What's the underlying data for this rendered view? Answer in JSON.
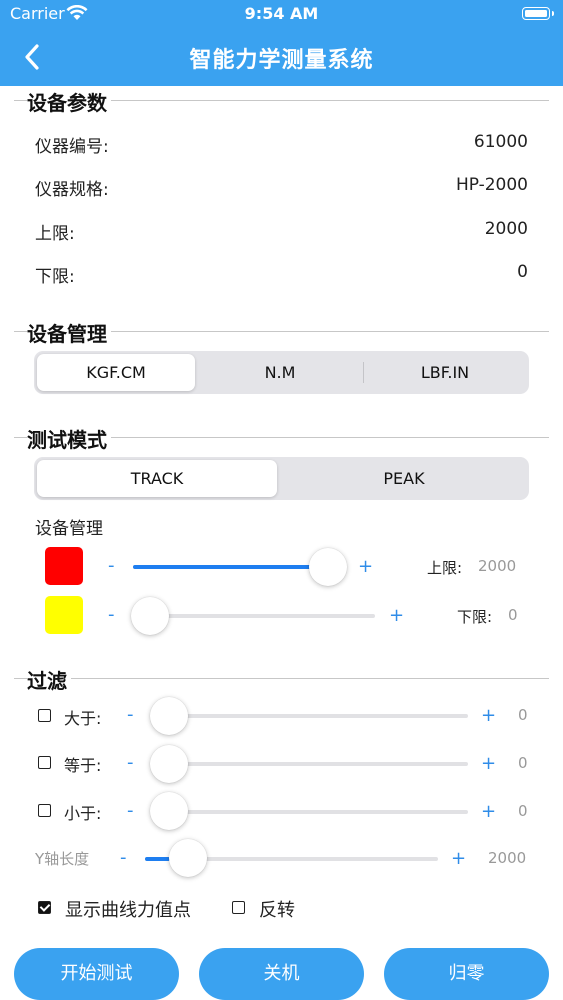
{
  "status": {
    "carrier": "Carrier",
    "time": "9:54 AM"
  },
  "nav": {
    "title": "智能力学测量系统",
    "back_icon": "chevron-left-icon"
  },
  "device_params": {
    "title": "设备参数",
    "rows": [
      {
        "label": "仪器编号:",
        "value": "61000"
      },
      {
        "label": "仪器规格:",
        "value": "HP-2000"
      },
      {
        "label": "上限:",
        "value": "2000"
      },
      {
        "label": "下限:",
        "value": "0"
      }
    ]
  },
  "device_mgmt": {
    "title": "设备管理",
    "units": [
      "KGF.CM",
      "N.M",
      "LBF.IN"
    ],
    "selected": "KGF.CM"
  },
  "test_mode": {
    "title": "测试模式",
    "modes": [
      "TRACK",
      "PEAK"
    ],
    "selected": "TRACK",
    "sub_title": "设备管理",
    "upper": {
      "color": "#ff0000",
      "minus": "-",
      "plus": "+",
      "label": "上限:",
      "value": "2000",
      "level": 1.0
    },
    "lower": {
      "color": "#ffff00",
      "minus": "-",
      "plus": "+",
      "label": "下限:",
      "value": "0",
      "level": 0.0
    }
  },
  "filter": {
    "title": "过滤",
    "rows": [
      {
        "label": "大于:",
        "minus": "-",
        "plus": "+",
        "value": "0",
        "checked": false
      },
      {
        "label": "等于:",
        "minus": "-",
        "plus": "+",
        "value": "0",
        "checked": false
      },
      {
        "label": "小于:",
        "minus": "-",
        "plus": "+",
        "value": "0",
        "checked": false
      }
    ],
    "y_axis": {
      "label": "Y轴长度",
      "minus": "-",
      "plus": "+",
      "value": "2000"
    },
    "show_points": {
      "label": "显示曲线力值点",
      "checked": true
    },
    "reverse": {
      "label": "反转",
      "checked": false
    }
  },
  "buttons": {
    "start": "开始测试",
    "shutdown": "关机",
    "zero": "归零"
  },
  "colors": {
    "accent": "#3aa2f0",
    "slider_fill": "#1e7ef0"
  }
}
